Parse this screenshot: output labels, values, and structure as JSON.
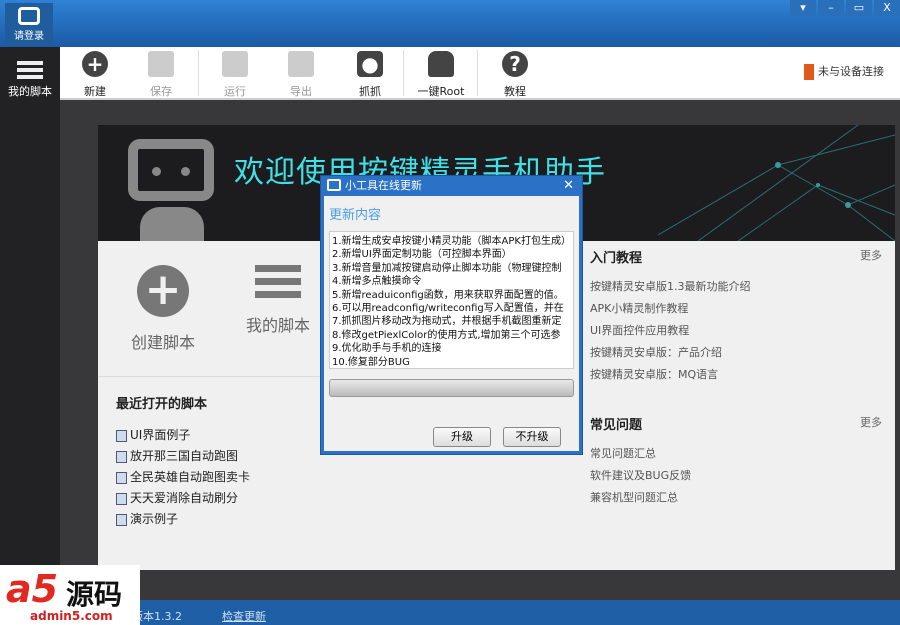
{
  "titlebar": {
    "login_label": "请登录",
    "window_buttons": [
      "▾",
      "–",
      "▭",
      "X"
    ]
  },
  "sidebar": {
    "items": [
      {
        "label": "我的脚本",
        "icon": "list-icon"
      }
    ]
  },
  "toolbar": {
    "buttons": [
      {
        "label": "新建",
        "icon": "plus-circle-icon",
        "enabled": true
      },
      {
        "label": "保存",
        "icon": "save-icon",
        "enabled": false
      },
      {
        "label": "运行",
        "icon": "run-icon",
        "enabled": false
      },
      {
        "label": "导出",
        "icon": "export-icon",
        "enabled": false
      },
      {
        "label": "抓抓",
        "icon": "camera-icon",
        "enabled": true
      },
      {
        "label": "一键Root",
        "icon": "android-icon",
        "enabled": true
      },
      {
        "label": "教程",
        "icon": "help-icon",
        "enabled": true
      }
    ],
    "device_status": "未与设备连接"
  },
  "main": {
    "welcome": "欢迎使用按键精灵手机助手",
    "quick": [
      {
        "label": "创建脚本"
      },
      {
        "label": "我的脚本"
      }
    ],
    "recent_title": "最近打开的脚本",
    "recent": [
      "UI界面例子",
      "放开那三国自动跑图",
      "全民英雄自动跑图卖卡",
      "天天爱消除自动刷分",
      "演示例子"
    ],
    "tutorials": {
      "title": "入门教程",
      "more": "更多",
      "items": [
        "按键精灵安卓版1.3最新功能介绍",
        "APK小精灵制作教程",
        "UI界面控件应用教程",
        "按键精灵安卓版：产品介绍",
        "按键精灵安卓版：MQ语言"
      ]
    },
    "faq": {
      "title": "常见问题",
      "more": "更多",
      "items": [
        "常见问题汇总",
        "软件建议及BUG反馈",
        "兼容机型问题汇总"
      ]
    }
  },
  "dialog": {
    "title": "小工具在线更新",
    "heading": "更新内容",
    "lines": [
      "1.新增生成安卓按键小精灵功能（脚本APK打包生成）",
      "2.新增UI界面定制功能（可控脚本界面）",
      "3.新增音量加减按键启动停止脚本功能（物理键控制",
      "4.新增多点触摸命令",
      "5.新增readuiconfig函数，用来获取界面配置的值。",
      "6.可以用readconfig/writeconfig写入配置值，并在",
      "7.抓抓图片移动改为拖动式，并根据手机截图重新定",
      "8.修改getPiexlColor的使用方式,增加第三个可选参",
      "9.优化助手与手机的连接",
      "10.修复部分BUG"
    ],
    "progress": 0,
    "upgrade": "升级",
    "no_upgrade": "不升级"
  },
  "status": {
    "version": "版本1.3.2",
    "check_update": "检查更新"
  },
  "watermark": {
    "logo": "a5源码",
    "url": "admin5.com"
  },
  "colors": {
    "titlebar": "#1b5aa6",
    "accent": "#3fe0e6",
    "dialog": "#2b71c6"
  }
}
